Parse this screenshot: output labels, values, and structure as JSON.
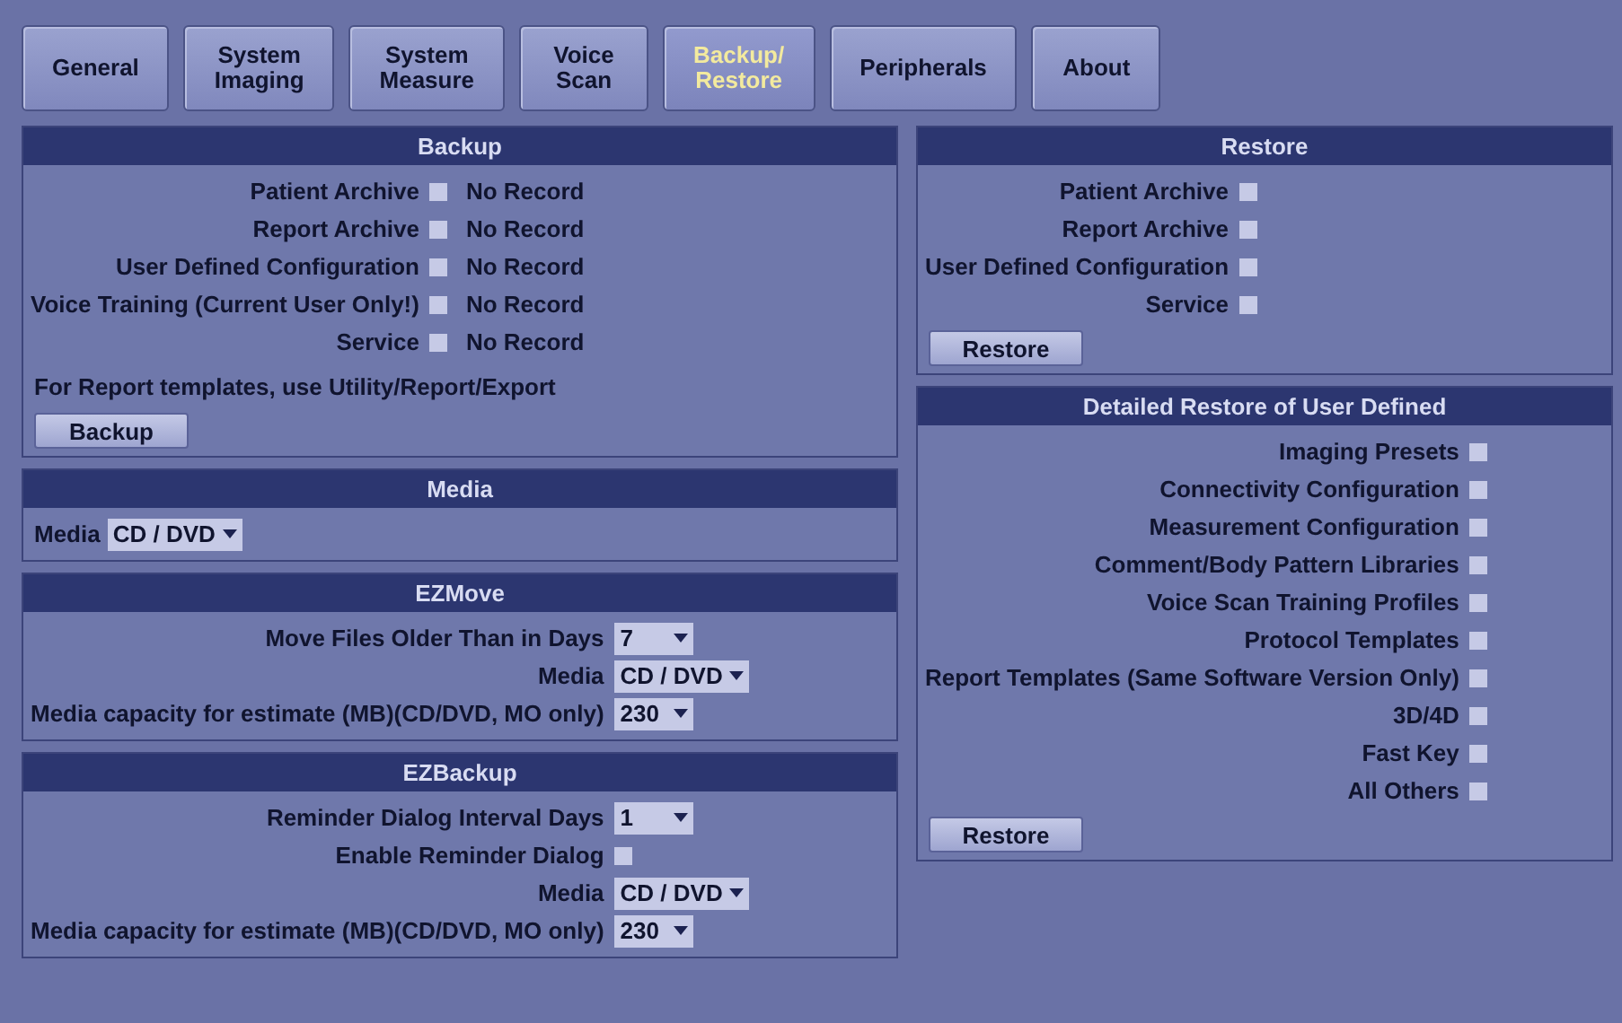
{
  "tabs": [
    {
      "label": "General",
      "selected": false
    },
    {
      "label": "System\nImaging",
      "selected": false
    },
    {
      "label": "System\nMeasure",
      "selected": false
    },
    {
      "label": "Voice\nScan",
      "selected": false
    },
    {
      "label": "Backup/\nRestore",
      "selected": true
    },
    {
      "label": "Peripherals",
      "selected": false
    },
    {
      "label": "About",
      "selected": false
    }
  ],
  "left_panels": [
    {
      "title": "Backup",
      "rows": [
        {
          "kind": "checkbox",
          "label": "Patient Archive",
          "checked": false,
          "status": "No Record"
        },
        {
          "kind": "checkbox",
          "label": "Report Archive",
          "checked": false,
          "status": "No Record"
        },
        {
          "kind": "checkbox",
          "label": "User Defined Configuration",
          "checked": false,
          "status": "No Record"
        },
        {
          "kind": "checkbox",
          "label": "Voice Training (Current User Only!)",
          "checked": false,
          "status": "No Record"
        },
        {
          "kind": "checkbox",
          "label": "Service",
          "checked": false,
          "status": "No Record"
        }
      ],
      "note": "For Report templates, use Utility/Report/Export",
      "button": "Backup"
    },
    {
      "title": "Media",
      "rows": [
        {
          "kind": "dropdown",
          "label": "Media",
          "value": "CD / DVD"
        }
      ]
    },
    {
      "title": "EZMove",
      "rows": [
        {
          "kind": "dropdown",
          "label": "Move Files Older Than in Days",
          "value": "7"
        },
        {
          "kind": "dropdown",
          "label": "Media",
          "value": "CD / DVD"
        },
        {
          "kind": "dropdown",
          "label": "Media capacity for estimate (MB)(CD/DVD, MO only)",
          "value": "230"
        }
      ]
    },
    {
      "title": "EZBackup",
      "rows": [
        {
          "kind": "dropdown",
          "label": "Reminder Dialog Interval Days",
          "value": "1"
        },
        {
          "kind": "checkbox",
          "label": "Enable Reminder Dialog",
          "checked": false
        },
        {
          "kind": "dropdown",
          "label": "Media",
          "value": "CD / DVD"
        },
        {
          "kind": "dropdown",
          "label": "Media capacity for estimate (MB)(CD/DVD, MO only)",
          "value": "230"
        }
      ]
    }
  ],
  "right_panels": [
    {
      "title": "Restore",
      "rows": [
        {
          "kind": "checkbox",
          "label": "Patient Archive",
          "checked": false
        },
        {
          "kind": "checkbox",
          "label": "Report Archive",
          "checked": false
        },
        {
          "kind": "checkbox",
          "label": "User Defined Configuration",
          "checked": false
        },
        {
          "kind": "checkbox",
          "label": "Service",
          "checked": false
        }
      ],
      "button": "Restore"
    },
    {
      "title": "Detailed Restore of User Defined",
      "rows": [
        {
          "kind": "checkbox",
          "label": "Imaging Presets",
          "checked": false
        },
        {
          "kind": "checkbox",
          "label": "Connectivity Configuration",
          "checked": false
        },
        {
          "kind": "checkbox",
          "label": "Measurement Configuration",
          "checked": false
        },
        {
          "kind": "checkbox",
          "label": "Comment/Body Pattern Libraries",
          "checked": false
        },
        {
          "kind": "checkbox",
          "label": "Voice Scan Training Profiles",
          "checked": false
        },
        {
          "kind": "checkbox",
          "label": "Protocol Templates",
          "checked": false
        },
        {
          "kind": "checkbox",
          "label": "Report Templates (Same Software Version Only)",
          "checked": false
        },
        {
          "kind": "checkbox",
          "label": "3D/4D",
          "checked": false
        },
        {
          "kind": "checkbox",
          "label": "Fast Key",
          "checked": false
        },
        {
          "kind": "checkbox",
          "label": "All Others",
          "checked": false
        }
      ],
      "button": "Restore"
    }
  ]
}
